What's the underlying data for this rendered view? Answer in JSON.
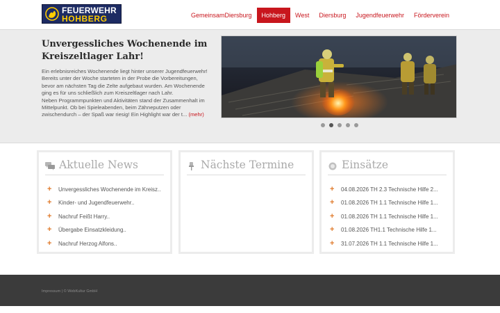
{
  "logo": {
    "line1": "FEUERWEHR",
    "line2": "HOHBERG",
    "bg_color": "#1d2b63",
    "accent_color": "#ffcc00"
  },
  "nav": {
    "items": [
      {
        "label": "GemeinsamDiersburg",
        "active": false
      },
      {
        "label": "Hohberg",
        "active": true
      },
      {
        "label": "West",
        "active": false
      },
      {
        "label": "Diersburg",
        "active": false
      },
      {
        "label": "Jugendfeuerwehr",
        "active": false
      },
      {
        "label": "Förderverein",
        "active": false
      }
    ],
    "accent_color": "#c8161d"
  },
  "hero": {
    "title": "Unvergessliches Wochenende im Kreiszeltlager Lahr!",
    "text": "Ein erlebnisreiches Wochenende liegt hinter unserer Jugendfeuerwehr! Bereits unter der Woche starteten in der Probe die Vorbereitungen, bevor am nächsten Tag die Zelte aufgebaut wurden. Am Wochenende ging es für uns schließlich zum Kreiszeltlager nach Lahr.\nNeben Programmpunkten und Aktivitäten stand der Zusammenhalt im Mittelpunkt. Ob bei Spieleabenden, beim Zähneputzen oder zwischendurch – der Spaß war riesig! Ein Highlight war der t... ",
    "more_label": "(mehr)",
    "slider_dots": 5,
    "active_dot": 2
  },
  "panels": {
    "news": {
      "title": "Aktuelle News",
      "icon": "chat-bubbles-icon",
      "items": [
        "Unvergessliches Wochenende im Kreisz..",
        "Kinder- und Jugendfeuerwehr..",
        "Nachruf Feißt Harry..",
        "Übergabe Einsatzkleidung..",
        "Nachruf Herzog Alfons.."
      ]
    },
    "termine": {
      "title": "Nächste Termine",
      "icon": "pushpin-icon",
      "items": []
    },
    "einsaetze": {
      "title": "Einsätze",
      "icon": "siren-icon",
      "items": [
        "04.08.2026 TH 2.3 Technische Hilfe 2...",
        "01.08.2026 TH 1.1 Technische Hilfe 1...",
        "01.08.2026 TH 1.1 Technische Hilfe 1...",
        "01.08.2026 TH1.1 Technische Hilfe 1...",
        "31.07.2026 TH 1.1 Technische Hilfe 1..."
      ]
    }
  },
  "footer": {
    "text": "Impressum | © WebKultur GmbH"
  }
}
